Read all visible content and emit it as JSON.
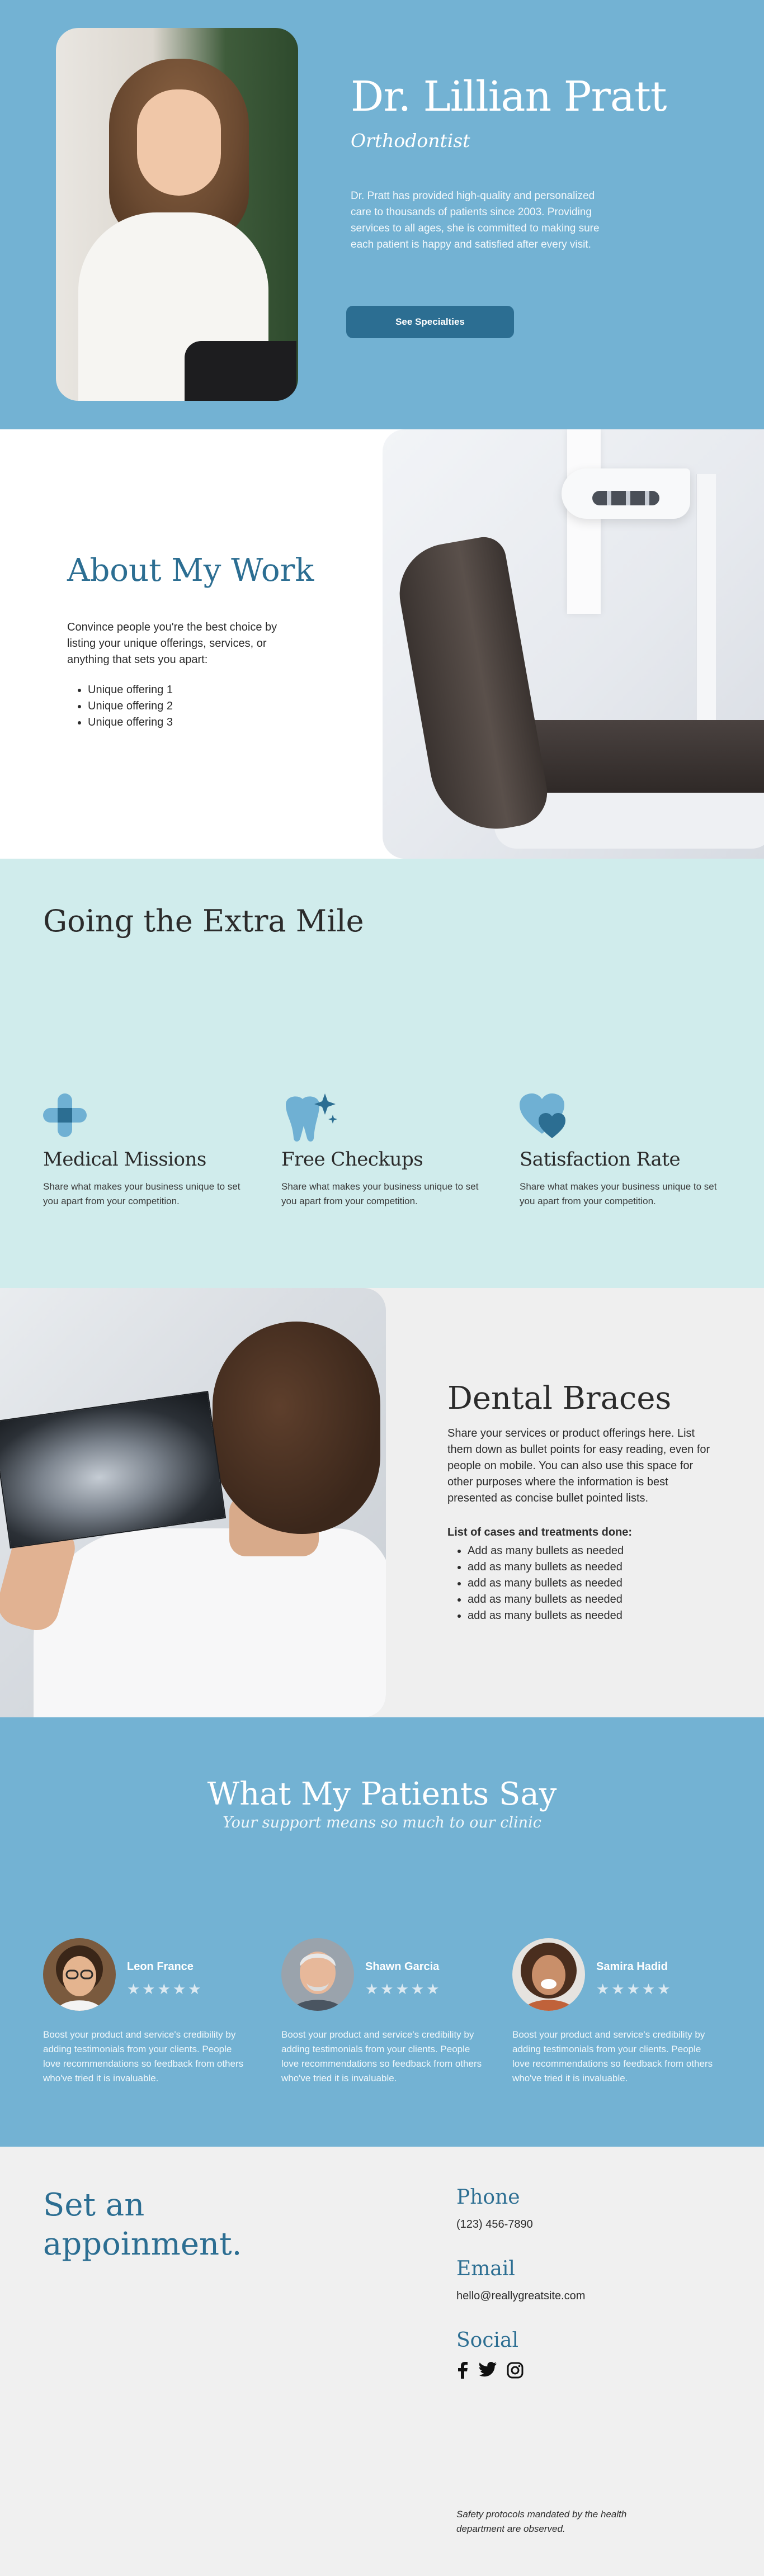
{
  "colors": {
    "primary": "#73b2d3",
    "accent": "#2c6e92",
    "mint": "#d0ecec",
    "light": "#efefef"
  },
  "hero": {
    "name": "Dr. Lillian Pratt",
    "title": "Orthodontist",
    "intro": "Dr. Pratt has provided high-quality and personalized care to thousands of patients since 2003. Providing services to all ages, she is committed to making sure each patient is happy and satisfied after every visit.",
    "cta_label": "See Specialties"
  },
  "about": {
    "heading": "About My Work",
    "description": "Convince people you're the best choice by listing  your unique offerings, services, or anything that sets you apart:",
    "items": [
      "Unique offering 1",
      "Unique offering 2",
      "Unique offering 3"
    ]
  },
  "extra": {
    "heading": "Going the Extra Mile",
    "features": [
      {
        "icon": "medical-cross-icon",
        "title": "Medical Missions",
        "text": "Share what makes your business unique to set you apart from your competition."
      },
      {
        "icon": "sparkling-tooth-icon",
        "title": "Free Checkups",
        "text": "Share what makes your business unique to set you apart from your competition."
      },
      {
        "icon": "hearts-icon",
        "title": "Satisfaction Rate",
        "text": "Share what makes your business unique to set you apart from your competition."
      }
    ]
  },
  "braces": {
    "heading": "Dental Braces",
    "description": "Share your services or product offerings here. List them down as bullet points for easy reading, even for people on mobile. You can also use this space for other purposes where the information is best presented as concise bullet pointed lists.",
    "list_title": "List of cases and treatments done:",
    "items": [
      "Add as many bullets as needed",
      "add as many bullets as needed",
      "add as many bullets as needed",
      "add as many bullets as needed",
      "add as many bullets as needed"
    ]
  },
  "testimonials": {
    "heading": "What My Patients Say",
    "subheading": "Your support means so much to our clinic",
    "stars": "★★★★★",
    "items": [
      {
        "name": "Leon France",
        "text": "Boost your product and service's credibility by adding testimonials from your clients. People love recommendations so feedback from others who've tried it is invaluable."
      },
      {
        "name": "Shawn Garcia",
        "text": "Boost your product and service's credibility by adding testimonials from your clients. People love recommendations so feedback from others who've tried it is invaluable."
      },
      {
        "name": "Samira Hadid",
        "text": "Boost your product and service's credibility by adding testimonials from your clients. People love recommendations so feedback from others who've tried it is invaluable."
      }
    ]
  },
  "contact": {
    "heading": "Set an appoinment.",
    "phone_label": "Phone",
    "phone": "(123) 456-7890",
    "email_label": "Email",
    "email": "hello@reallygreatsite.com",
    "social_label": "Social",
    "socials": [
      "facebook-icon",
      "twitter-icon",
      "instagram-icon"
    ],
    "footnote": "Safety protocols mandated by the health department are observed."
  }
}
